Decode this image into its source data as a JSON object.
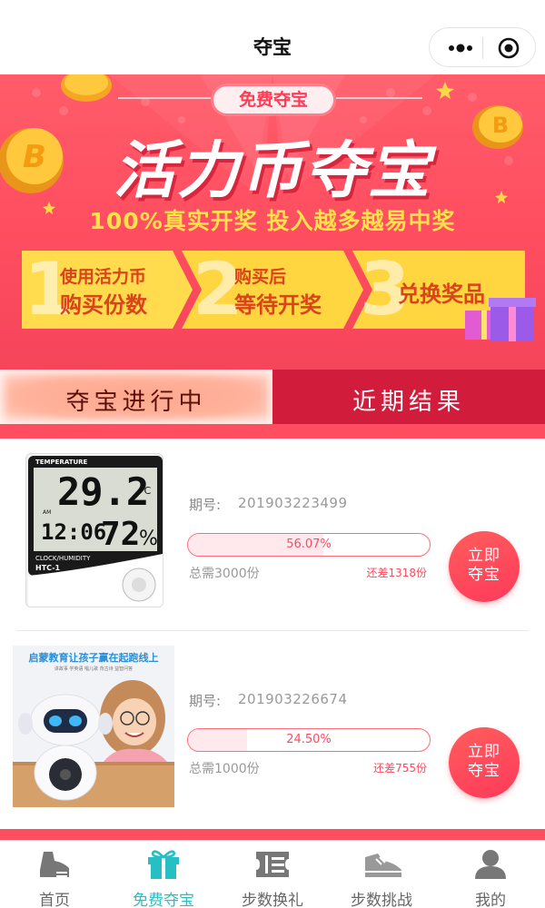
{
  "nav": {
    "title": "夺宝"
  },
  "banner": {
    "pill": "免费夺宝",
    "title": "活力币夺宝",
    "subtitle": "100%真实开奖 投入越多越易中奖",
    "steps": [
      {
        "num": "1",
        "line1": "使用活力币",
        "line2": "购买份数"
      },
      {
        "num": "2",
        "line1": "购买后",
        "line2": "等待开奖"
      },
      {
        "num": "3",
        "line1": "",
        "line2": "兑换奖品"
      }
    ],
    "coin_letter": "B"
  },
  "tabs": [
    {
      "label": "夺宝进行中",
      "active": true
    },
    {
      "label": "近期结果",
      "active": false
    }
  ],
  "items": [
    {
      "period_label": "期号:",
      "period": "201903223499",
      "progress": 56.07,
      "progress_text": "56.07%",
      "total": "总需3000份",
      "remain": "还差1318份",
      "button": [
        "立即",
        "夺宝"
      ],
      "thumb": {
        "brand": "TEMPERATURE",
        "temp": "29.2",
        "unit": "°C",
        "time": "12:06",
        "humidity": "72",
        "pct": "%",
        "am": "AM",
        "model_top": "CLOCK/HUMIDITY",
        "model": "HTC-1"
      }
    },
    {
      "period_label": "期号:",
      "period": "201903226674",
      "progress": 24.5,
      "progress_text": "24.50%",
      "total": "总需1000份",
      "remain": "还差755份",
      "button": [
        "立即",
        "夺宝"
      ],
      "thumb": {
        "headline": "启蒙教育让孩子赢在起跑线上",
        "sub": "讲故事 学英语 唱儿歌 背古诗 益智问答"
      }
    }
  ],
  "tabbar": [
    {
      "label": "首页",
      "icon": "shoe-icon",
      "active": false
    },
    {
      "label": "免费夺宝",
      "icon": "gift-icon",
      "active": true
    },
    {
      "label": "步数换礼",
      "icon": "ticket-icon",
      "active": false
    },
    {
      "label": "步数挑战",
      "icon": "sneaker-icon",
      "active": false
    },
    {
      "label": "我的",
      "icon": "user-icon",
      "active": false
    }
  ],
  "colors": {
    "primary_red": "#ff4e5f",
    "dark_red": "#d11c3b",
    "accent_teal": "#25bfc4",
    "gold": "#ffe14a"
  }
}
